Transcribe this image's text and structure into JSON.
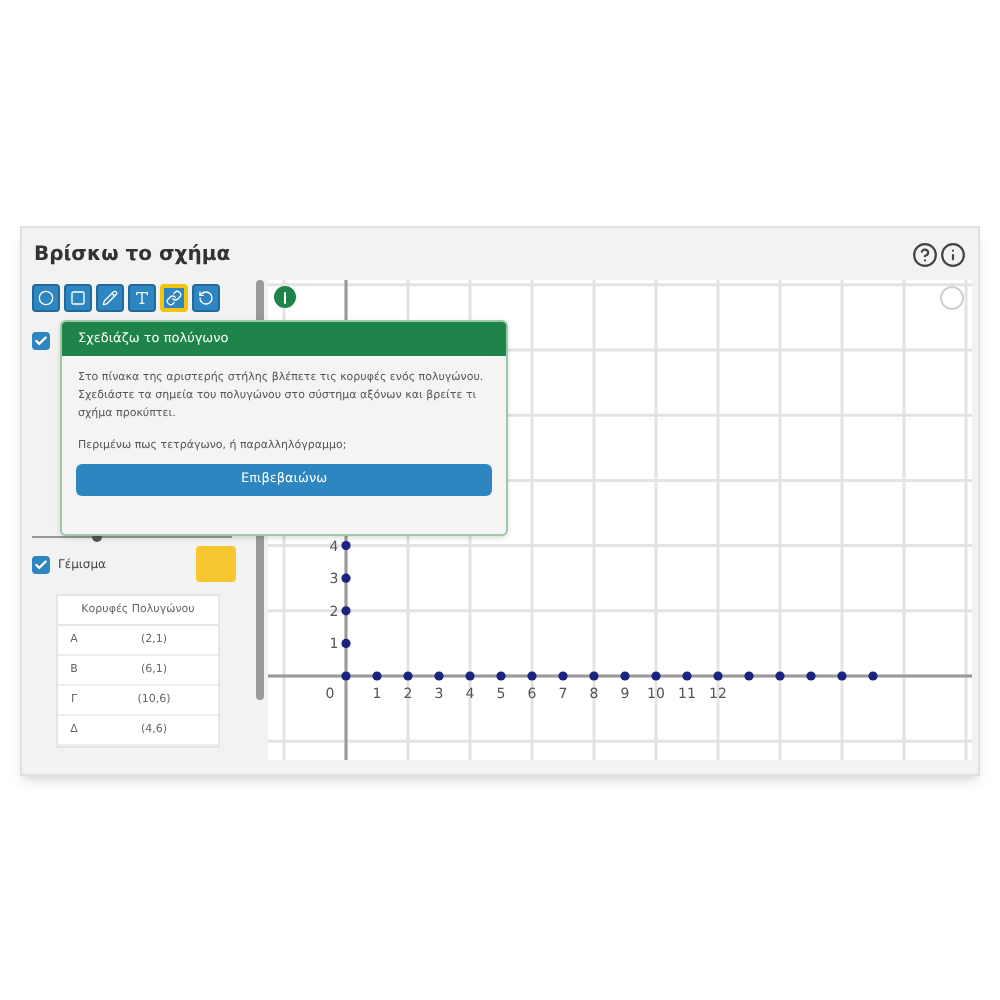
{
  "title": "Βρίσκω το σχήμα",
  "toolbar": [
    {
      "selected": false
    },
    {
      "selected": false
    },
    {
      "selected": false
    },
    {
      "selected": false
    },
    {
      "selected": true
    },
    {
      "selected": false
    }
  ],
  "sidebar": {
    "show_checkbox": {
      "checked": true
    },
    "fill": {
      "label": "Γέμισμα",
      "checked": true,
      "color": "#f8c630"
    },
    "table": {
      "header": "Κορυφές Πολυγώνου",
      "rows": [
        {
          "label": "Α",
          "value": "(2,1)"
        },
        {
          "label": "Β",
          "value": "(6,1)"
        },
        {
          "label": "Γ",
          "value": "(10,6)"
        },
        {
          "label": "Δ",
          "value": "(4,6)"
        }
      ]
    }
  },
  "dialog": {
    "title": "Σχεδιάζω το πολύγωνο",
    "text": "Στο πίνακα της αριστερής στήλης βλέπετε τις κορυφές ενός πολυγώνου. Σχεδιάστε τα σημεία του πολυγώνου στο σύστημα αξόνων και βρείτε τι σχήμα προκύπτει.",
    "question": "Περιμένω πως τετράγωνο, ή παραλληλόγραμμο;",
    "button": "Επιβεβαιώνω"
  },
  "graph": {
    "x_labels": [
      "0",
      "1",
      "2",
      "3",
      "4",
      "5",
      "6",
      "7",
      "8",
      "9",
      "10",
      "11",
      "12"
    ],
    "y_labels": [
      "4",
      "3",
      "2",
      "1"
    ]
  }
}
